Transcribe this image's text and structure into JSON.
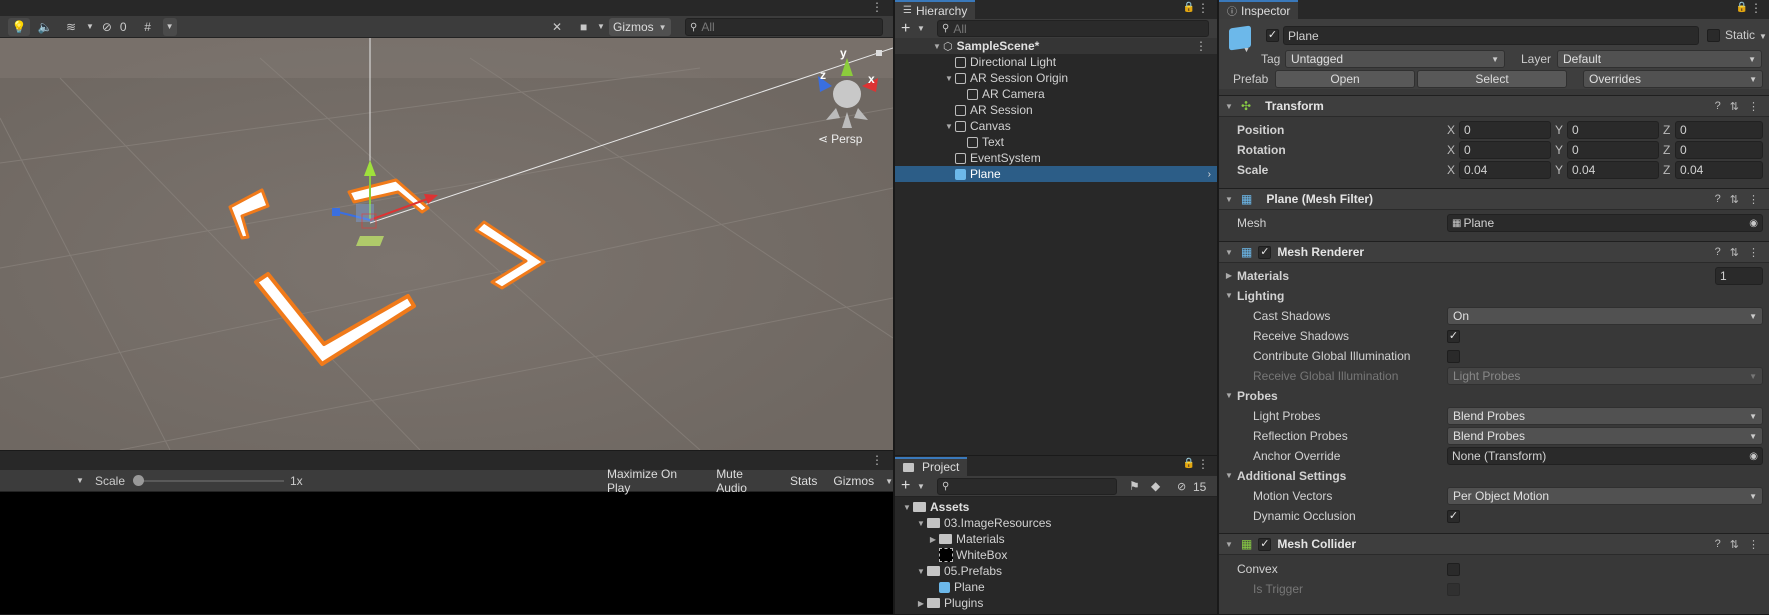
{
  "scene": {
    "gizmos_label": "Gizmos",
    "search_placeholder": "All",
    "hidden_count": "0",
    "persp_label": "Persp",
    "axis_y": "y",
    "axis_x": "x",
    "axis_z": "z"
  },
  "game": {
    "scale_label": "Scale",
    "scale_value": "1x",
    "buttons": [
      "Maximize On Play",
      "Mute Audio",
      "Stats",
      "Gizmos"
    ]
  },
  "hierarchy": {
    "tab": "Hierarchy",
    "search_placeholder": "All",
    "scene_name": "SampleScene*",
    "items": [
      "Directional Light",
      "AR Session Origin",
      "AR Camera",
      "AR Session",
      "Canvas",
      "Text",
      "EventSystem",
      "Plane"
    ]
  },
  "project": {
    "tab": "Project",
    "hidden_count": "15",
    "items": [
      "Assets",
      "03.ImageResources",
      "Materials",
      "WhiteBox",
      "05.Prefabs",
      "Plane",
      "Plugins"
    ]
  },
  "inspector": {
    "tab": "Inspector",
    "object_name": "Plane",
    "static_label": "Static",
    "tag_label": "Tag",
    "tag_value": "Untagged",
    "layer_label": "Layer",
    "layer_value": "Default",
    "prefab_label": "Prefab",
    "prefab_open": "Open",
    "prefab_select": "Select",
    "prefab_overrides": "Overrides",
    "transform": {
      "title": "Transform",
      "position_label": "Position",
      "rotation_label": "Rotation",
      "scale_label": "Scale",
      "position": [
        "0",
        "0",
        "0"
      ],
      "rotation": [
        "0",
        "0",
        "0"
      ],
      "scale": [
        "0.04",
        "0.04",
        "0.04"
      ],
      "x": "X",
      "y": "Y",
      "z": "Z"
    },
    "mesh_filter": {
      "title": "Plane (Mesh Filter)",
      "mesh_label": "Mesh",
      "mesh_value": "Plane"
    },
    "mesh_renderer": {
      "title": "Mesh Renderer",
      "materials_label": "Materials",
      "materials_count": "1",
      "lighting_label": "Lighting",
      "cast_shadows_label": "Cast Shadows",
      "cast_shadows_value": "On",
      "receive_shadows_label": "Receive Shadows",
      "contribute_gi_label": "Contribute Global Illumination",
      "receive_gi_label": "Receive Global Illumination",
      "receive_gi_value": "Light Probes",
      "probes_label": "Probes",
      "light_probes_label": "Light Probes",
      "light_probes_value": "Blend Probes",
      "reflection_probes_label": "Reflection Probes",
      "reflection_probes_value": "Blend Probes",
      "anchor_override_label": "Anchor Override",
      "anchor_override_value": "None (Transform)",
      "additional_label": "Additional Settings",
      "motion_vectors_label": "Motion Vectors",
      "motion_vectors_value": "Per Object Motion",
      "dynamic_occlusion_label": "Dynamic Occlusion"
    },
    "mesh_collider": {
      "title": "Mesh Collider",
      "convex_label": "Convex",
      "is_trigger_label": "Is Trigger"
    }
  },
  "colors": {
    "selection": "#2c5d87",
    "accent": "#3a79bb",
    "outline": "#f07a1a",
    "scene_bg": "#7a716b"
  }
}
